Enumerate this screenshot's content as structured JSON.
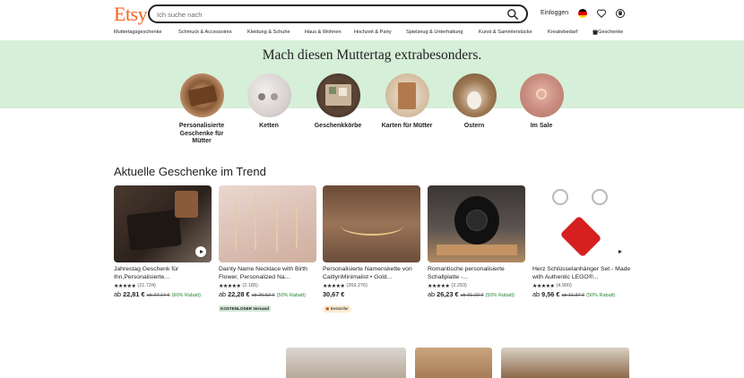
{
  "header": {
    "logo": "Etsy",
    "search_placeholder": "Ich suche nach",
    "signin_label": "Einloggen"
  },
  "nav": {
    "items": [
      "Muttertagsgeschenke",
      "Schmuck & Accessoires",
      "Kleidung & Schuhe",
      "Haus & Wohnen",
      "Hochzeit & Party",
      "Spielzeug & Unterhaltung",
      "Kunst & Sammlerstücke",
      "Kreativbedarf",
      "Geschenke"
    ]
  },
  "hero": {
    "title": "Mach diesen Muttertag extrabesonders.",
    "categories": [
      "Personalisierte Geschenke für Mütter",
      "Ketten",
      "Geschenkkörbe",
      "Karten für Mütter",
      "Ostern",
      "Im Sale"
    ]
  },
  "trending": {
    "title": "Aktuelle Geschenke im Trend",
    "products": [
      {
        "title": "Jahrestag Geschenk für Ihn,Personalisierte...",
        "reviews": "(21.724)",
        "price_prefix": "ab",
        "price": "22,81 €",
        "old_price": "ab 27,14 €",
        "discount": "(60% Rabatt)",
        "badge": ""
      },
      {
        "title": "Dainty Name Necklace with Birth Flower, Personalized Na...",
        "reviews": "(2.185)",
        "price_prefix": "ab",
        "price": "22,28 €",
        "old_price": "ab 26,52 €",
        "discount": "(50% Rabatt)",
        "badge": "KOSTENLOSER Versand"
      },
      {
        "title": "Personalisierte Namenskette von CaitlynMinimalist • Gold...",
        "reviews": "(269.276)",
        "price_prefix": "",
        "price": "30,67 €",
        "old_price": "",
        "discount": "",
        "badge": "Bestseller"
      },
      {
        "title": "Romantische personalisierte Schallplatte -...",
        "reviews": "(2.293)",
        "price_prefix": "ab",
        "price": "26,23 €",
        "old_price": "ab 31,22 €",
        "discount": "(50% Rabatt)",
        "badge": ""
      },
      {
        "title": "Herz Schlüsselanhänger Set - Made with Authentic LEGO®...",
        "reviews": "(4.900)",
        "price_prefix": "ab",
        "price": "9,56 €",
        "old_price": "ab 11,37 €",
        "discount": "(50% Rabatt)",
        "badge": ""
      }
    ]
  },
  "colors": {
    "brand": "#f1641e",
    "hero_bg": "#d6efd8",
    "discount": "#258635"
  },
  "icons": [
    "search-icon",
    "flag-de-icon",
    "heart-icon",
    "cart-icon",
    "gift-icon",
    "star-icon",
    "play-icon",
    "bestseller-icon"
  ]
}
